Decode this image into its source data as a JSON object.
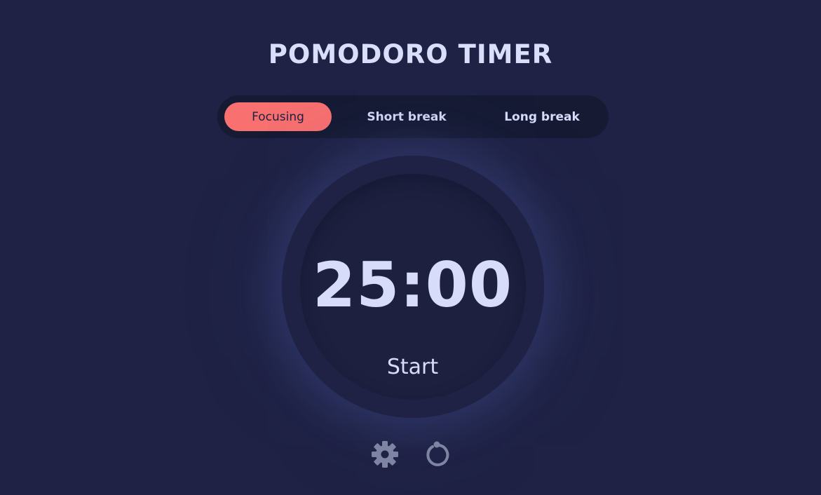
{
  "app": {
    "title": "POMODORO TIMER"
  },
  "tabs": [
    {
      "label": "Focusing",
      "active": true
    },
    {
      "label": "Short break",
      "active": false
    },
    {
      "label": "Long break",
      "active": false
    }
  ],
  "timer": {
    "time": "25:00",
    "action_label": "Start"
  },
  "icons": {
    "settings": "gear-icon",
    "restart": "restart-icon"
  },
  "colors": {
    "background": "#1f2244",
    "accent": "#f87070",
    "text": "#d7dcfa",
    "tab_bar": "#161a33",
    "icon": "#7e84a3"
  }
}
